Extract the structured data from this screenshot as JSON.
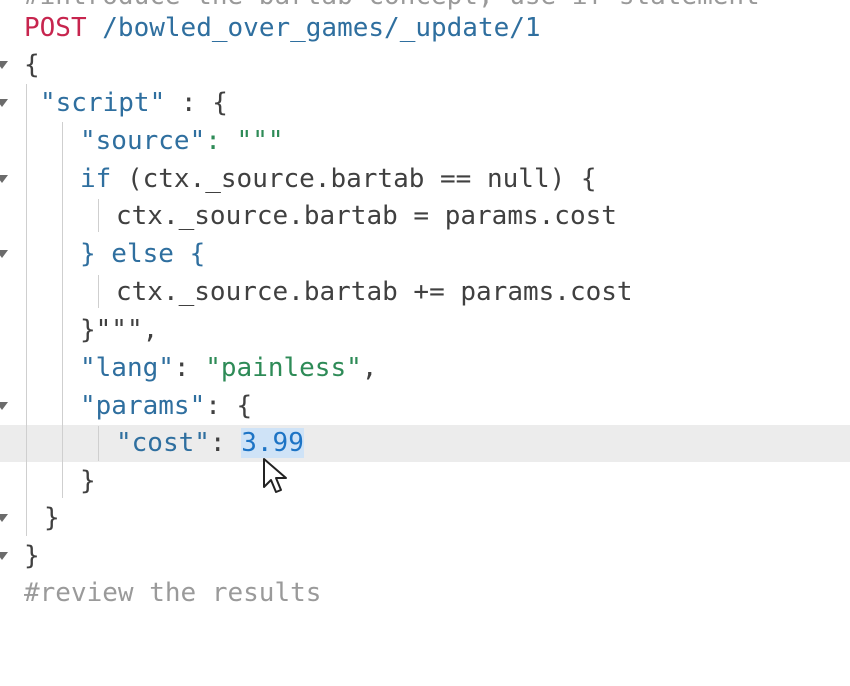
{
  "editor": {
    "top_faded_line": "#introduce the bartab concept, use if statement",
    "request": {
      "method": "POST",
      "path": "/bowled_over_games/_update/1"
    },
    "code": {
      "open_brace": "{",
      "script_key": "\"script\"",
      "colon_space_brace": " : {",
      "source_key": "\"source\"",
      "source_open": ": \"\"\"",
      "if_kw": "if",
      "if_cond": " (ctx._source.bartab == null) {",
      "assign_line": "ctx._source.bartab = params.cost",
      "else_line": "} else {",
      "add_assign_line": "ctx._source.bartab += params.cost",
      "source_close": "}\"\"\",",
      "lang_key": "\"lang\"",
      "lang_sep": ": ",
      "lang_val": "\"painless\"",
      "lang_comma": ",",
      "params_key": "\"params\"",
      "params_sep": ": {",
      "cost_key": "\"cost\"",
      "cost_sep": ": ",
      "cost_val": "3.99",
      "close_params": "}",
      "close_script": "}",
      "close_root": "}"
    },
    "bottom_faded_line": "#review the results"
  }
}
